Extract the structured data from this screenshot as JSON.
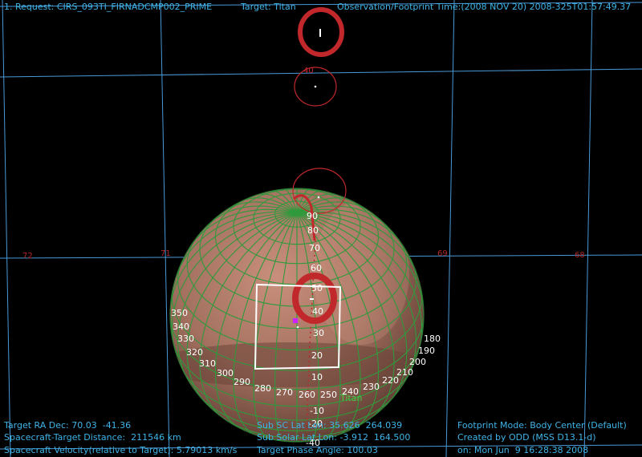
{
  "header": {
    "request": "1. Request: CIRS_093TI_FIRNADCMP002_PRIME",
    "target": "Target: Titan",
    "obs_time": "Observation/Footprint Time:(2008 NOV 20) 2008-325T01:57:49.37"
  },
  "ra_labels": [
    "72",
    "71",
    "69",
    "68"
  ],
  "small_tick_label": "40",
  "lat_labels": [
    "90",
    "80",
    "70",
    "60",
    "50",
    "40",
    "30",
    "20",
    "10",
    "-10",
    "-20",
    "-40"
  ],
  "lon_labels": [
    "350",
    "340",
    "330",
    "320",
    "310",
    "300",
    "290",
    "280",
    "270",
    "260",
    "250",
    "240",
    "230",
    "220",
    "210",
    "200",
    "190",
    "180"
  ],
  "body_label": "Titan",
  "footer": {
    "ra_dec": "Target RA Dec: 70.03  -41.36",
    "distance": "Spacecraft-Target Distance:  211546 km",
    "velocity": "Spacecraft Velocity(relative to Target): 5.79013 km/s",
    "sub_sc": "Sub SC Lat Lon: 35.626  264.039",
    "sub_solar": "Sub Solar Lat Lon: -3.912  164.500",
    "phase": "Target Phase Angle: 100.03",
    "mode": "Footprint Mode: Body Center (Default)",
    "created": "Created by ODD (MSS D13.1-d)",
    "date": "on: Mon Jun  9 16:28:38 2008"
  },
  "colors": {
    "background": "#000000",
    "hud_text": "#3fb4e8",
    "sky_grid": "#4a9ad8",
    "body_grid": "#2f9a3c",
    "footprint": "#c0282c",
    "ra_label": "#b02828",
    "box": "#ffffff",
    "marker": "#cc22ff",
    "body_label": "#44cc44"
  }
}
